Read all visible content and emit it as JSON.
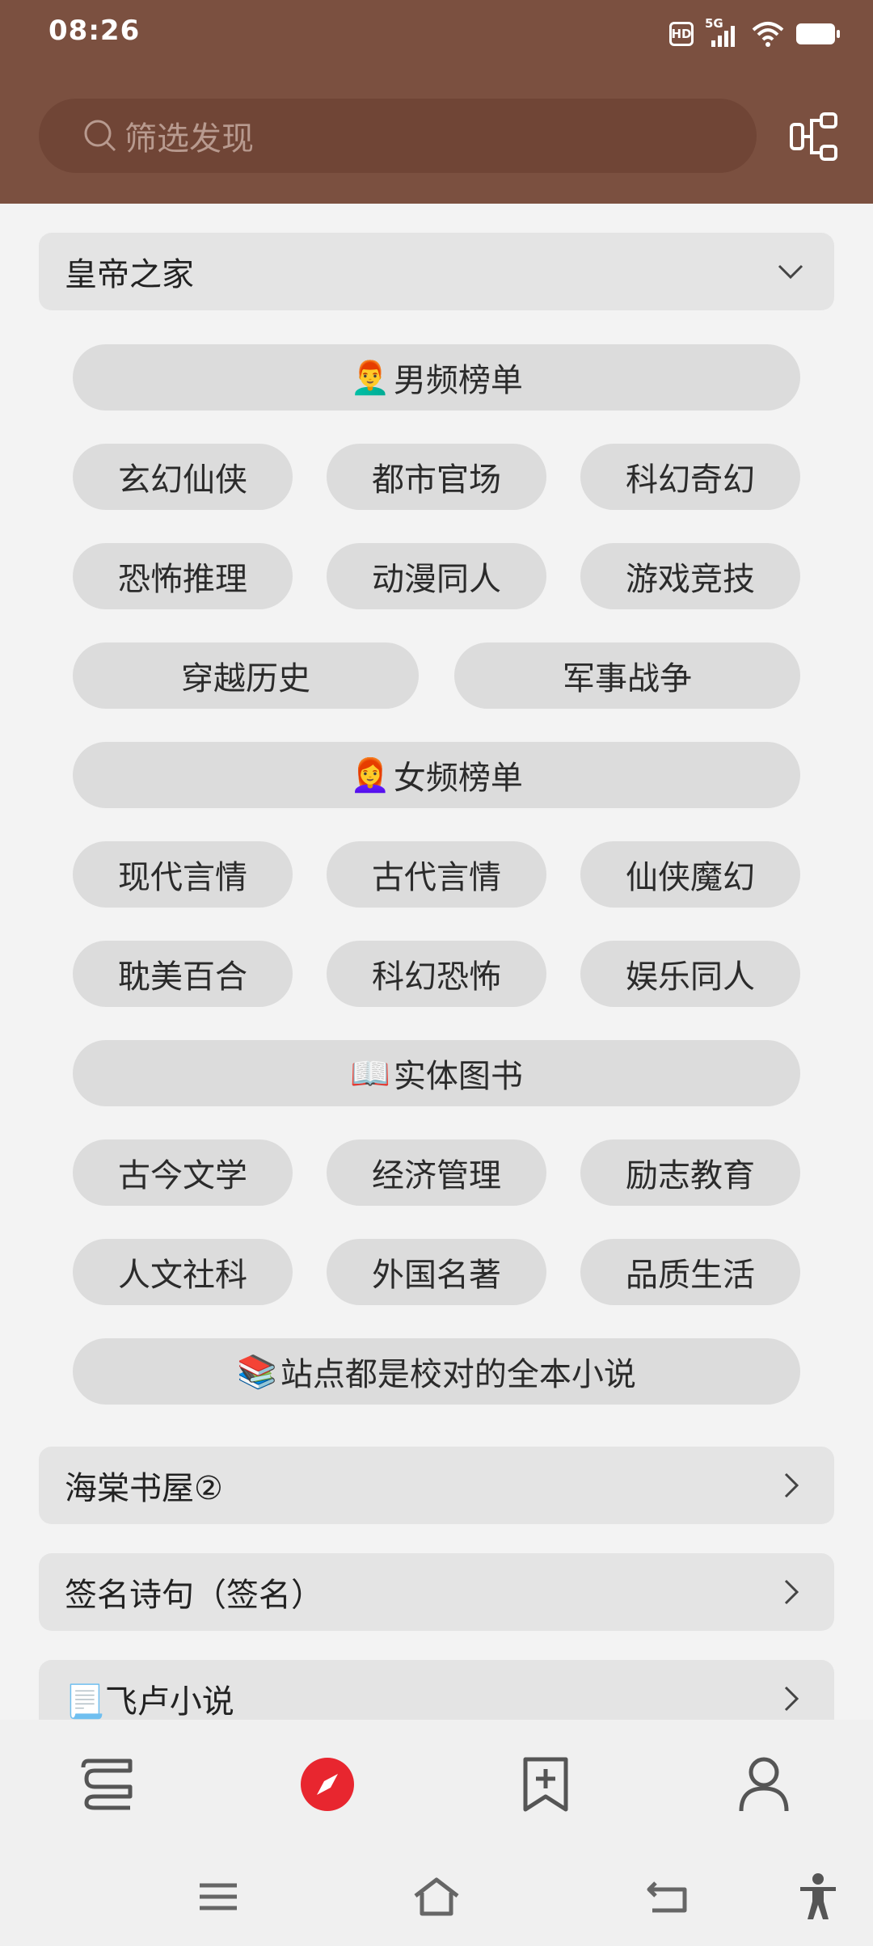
{
  "status_bar": {
    "time": "08:26",
    "hd_label": "HD",
    "network_label": "5G"
  },
  "search": {
    "placeholder": "筛选发现"
  },
  "sources": [
    {
      "title": "皇帝之家",
      "expanded": true
    },
    {
      "title": "海棠书屋②",
      "expanded": false
    },
    {
      "title": "签名诗句（签名）",
      "expanded": false
    },
    {
      "title": "飞卢小说",
      "icon": "📃",
      "expanded": false
    }
  ],
  "sections": {
    "male": {
      "emoji": "👨‍🦰",
      "label": "男频榜单"
    },
    "male_items": [
      "玄幻仙侠",
      "都市官场",
      "科幻奇幻",
      "恐怖推理",
      "动漫同人",
      "游戏竞技",
      "穿越历史",
      "军事战争"
    ],
    "female": {
      "emoji": "👩‍🦰",
      "label": "女频榜单"
    },
    "female_items": [
      "现代言情",
      "古代言情",
      "仙侠魔幻",
      "耽美百合",
      "科幻恐怖",
      "娱乐同人"
    ],
    "books": {
      "emoji": "📖",
      "label": "实体图书"
    },
    "books_items": [
      "古今文学",
      "经济管理",
      "励志教育",
      "人文社科",
      "外国名著",
      "品质生活"
    ],
    "note": {
      "emoji": "📚",
      "label": "站点都是校对的全本小说"
    }
  },
  "bottom_nav": {
    "items": [
      "bookshelf-icon",
      "discover-icon",
      "bookmark-add-icon",
      "profile-icon"
    ],
    "active_index": 1,
    "active_color": "#e8262f"
  },
  "colors": {
    "header": "#7b5040",
    "chip": "#dcdcdc"
  }
}
